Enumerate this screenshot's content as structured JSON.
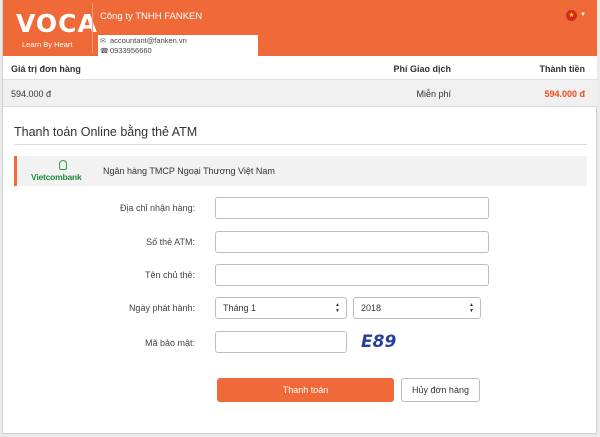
{
  "header": {
    "logo_word": "VOCA",
    "logo_tagline": "Learn By Heart",
    "company": "Công ty TNHH FANKEN",
    "email": "accountant@fanken.vn",
    "phone": "0933956660",
    "language_flag": "vn-flag-icon",
    "colors": {
      "brand": "#ef6a38"
    }
  },
  "summary": {
    "headers": [
      "Giá trị đơn hàng",
      "Phí Giao dịch",
      "Thành tiền"
    ],
    "order_value": "594.000 đ",
    "fee": "Miễn phí",
    "total": "594.000 đ",
    "colors": {
      "total": "#ef4a1a"
    }
  },
  "payment": {
    "title": "Thanh toán Online bằng thẻ ATM",
    "bank_logo_text": "Vietcombank",
    "bank_name": "Ngân hàng TMCP Ngoại Thương Việt Nam",
    "fields": {
      "address_label": "Địa chỉ nhận hàng:",
      "card_label": "Số thẻ ATM:",
      "holder_label": "Tên chủ thẻ:",
      "issue_label": "Ngày phát hành:",
      "month_value": "Tháng 1",
      "year_value": "2018",
      "security_label": "Mã bảo mật:",
      "captcha_text": "E89"
    },
    "buttons": {
      "pay": "Thanh toán",
      "cancel": "Hủy đơn hàng"
    }
  }
}
